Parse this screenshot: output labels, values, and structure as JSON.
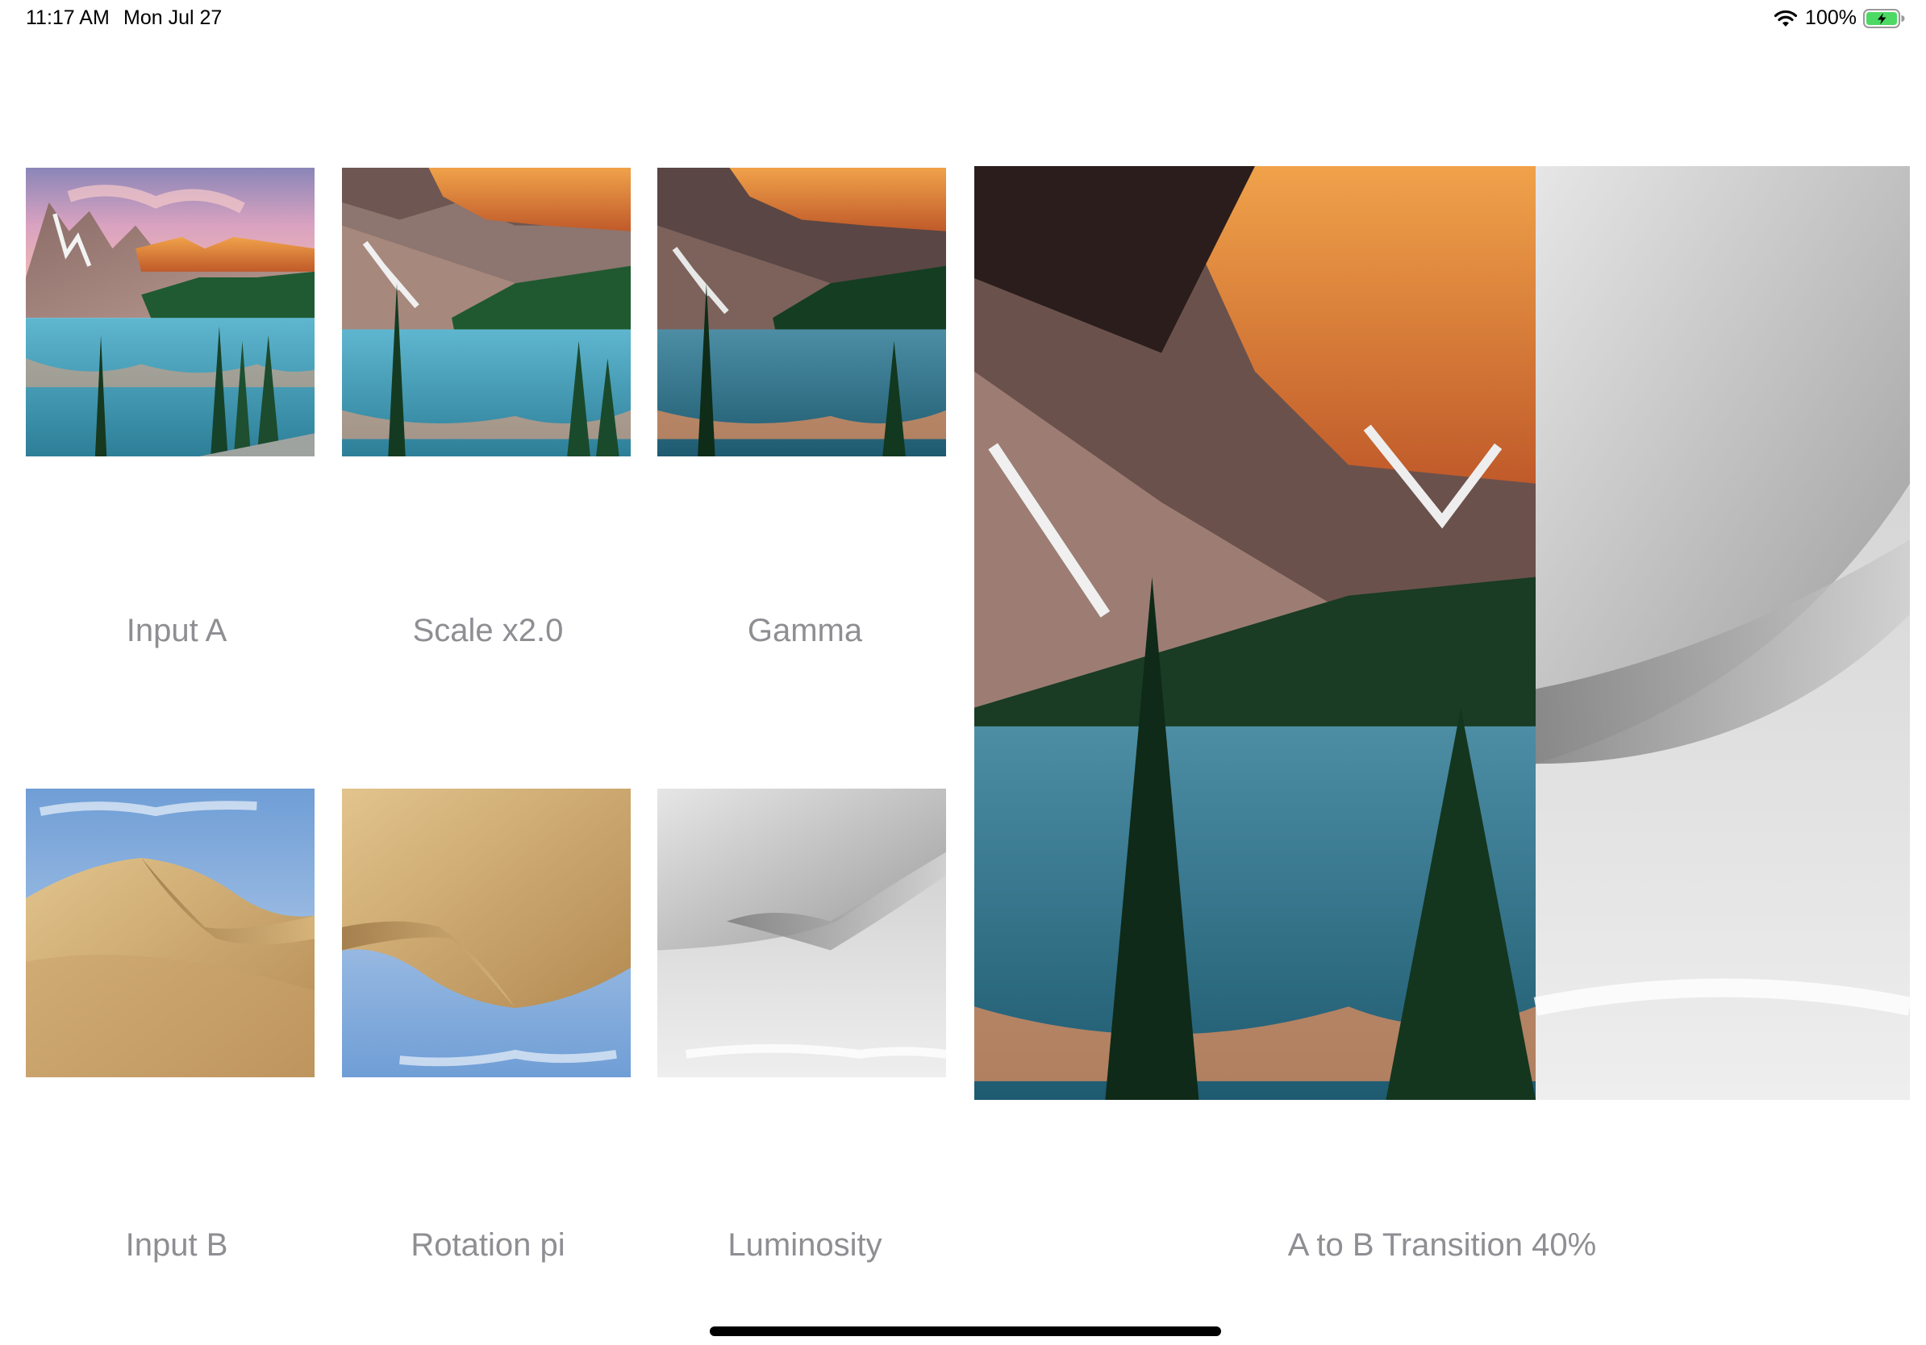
{
  "status_bar": {
    "time": "11:17 AM",
    "date": "Mon Jul 27",
    "battery_percent": "100%",
    "icons": [
      "wifi-icon",
      "battery-charging-icon"
    ]
  },
  "tiles": {
    "input_a": {
      "label": "Input A",
      "image": "lake-mountains-photo"
    },
    "scale": {
      "label": "Scale x2.0",
      "image": "lake-mountains-photo-scaled"
    },
    "gamma": {
      "label": "Gamma",
      "image": "lake-mountains-photo-gamma"
    },
    "input_b": {
      "label": "Input B",
      "image": "desert-dune-photo"
    },
    "rotation": {
      "label": "Rotation pi",
      "image": "desert-dune-photo-rotated"
    },
    "luminosity": {
      "label": "Luminosity",
      "image": "desert-dune-photo-grayscale"
    },
    "transition": {
      "label": "A to B Transition 40%",
      "image": "lake-to-dune-transition",
      "progress": 0.4
    }
  },
  "colors": {
    "label_text": "#8e8e93",
    "background": "#ffffff",
    "battery_fill": "#4cd964"
  }
}
